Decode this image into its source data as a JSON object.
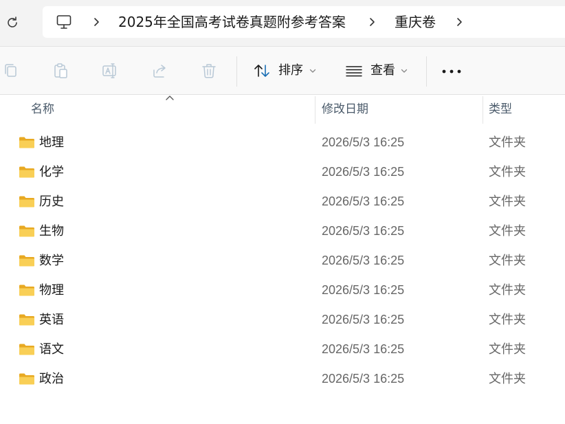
{
  "breadcrumb": {
    "items": [
      "2025年全国高考试卷真题附参考答案",
      "重庆卷"
    ]
  },
  "toolbar": {
    "sort_label": "排序",
    "view_label": "查看"
  },
  "columns": {
    "name": "名称",
    "date": "修改日期",
    "type": "类型"
  },
  "files": [
    {
      "name": "地理",
      "date": "2026/5/3 16:25",
      "type": "文件夹"
    },
    {
      "name": "化学",
      "date": "2026/5/3 16:25",
      "type": "文件夹"
    },
    {
      "name": "历史",
      "date": "2026/5/3 16:25",
      "type": "文件夹"
    },
    {
      "name": "生物",
      "date": "2026/5/3 16:25",
      "type": "文件夹"
    },
    {
      "name": "数学",
      "date": "2026/5/3 16:25",
      "type": "文件夹"
    },
    {
      "name": "物理",
      "date": "2026/5/3 16:25",
      "type": "文件夹"
    },
    {
      "name": "英语",
      "date": "2026/5/3 16:25",
      "type": "文件夹"
    },
    {
      "name": "语文",
      "date": "2026/5/3 16:25",
      "type": "文件夹"
    },
    {
      "name": "政治",
      "date": "2026/5/3 16:25",
      "type": "文件夹"
    }
  ],
  "colors": {
    "accent": "#1a6fb5",
    "folder": "#f6c445"
  }
}
